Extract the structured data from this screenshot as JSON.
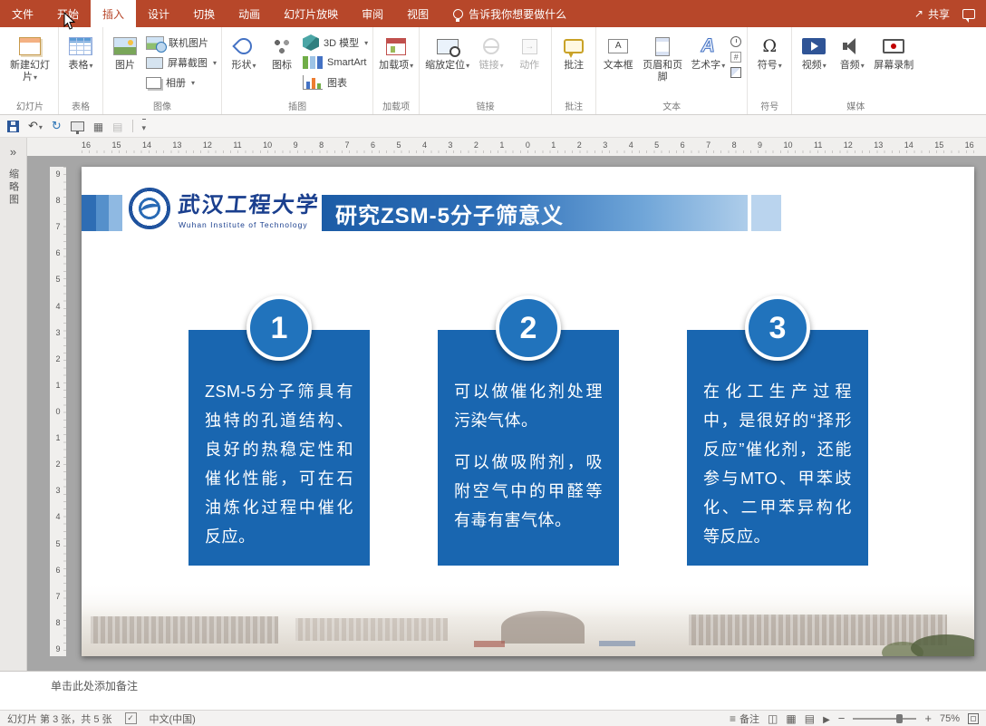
{
  "colors": {
    "ribbon_red": "#B7472A",
    "box_blue": "#1966B0",
    "title_gradient_start": "#1C5CA6",
    "title_gradient_end": "#AECDEA",
    "circle_blue": "#2173BC"
  },
  "tabs": {
    "items": [
      "文件",
      "开始",
      "插入",
      "设计",
      "切换",
      "动画",
      "幻灯片放映",
      "审阅",
      "视图"
    ],
    "active": "插入",
    "tell_me": "告诉我你想要做什么",
    "share_label": "共享"
  },
  "ribbon": {
    "slides": {
      "label": "幻灯片",
      "new_slide": "新建幻灯片"
    },
    "tables": {
      "label": "表格",
      "table": "表格"
    },
    "images": {
      "label": "图像",
      "picture": "图片",
      "online_pictures": "联机图片",
      "screenshot": "屏幕截图",
      "photo_album": "相册"
    },
    "illustrations": {
      "label": "插图",
      "shapes": "形状",
      "icons": "图标",
      "model_3d": "3D 模型",
      "smartart": "SmartArt",
      "chart": "图表"
    },
    "addins": {
      "label": "加载项",
      "addins": "加载项"
    },
    "links": {
      "label": "链接",
      "zoom": "缩放定位",
      "link": "链接",
      "action": "动作"
    },
    "comments": {
      "label": "批注",
      "comment": "批注"
    },
    "text": {
      "label": "文本",
      "text_box": "文本框",
      "header_footer": "页眉和页脚",
      "wordart": "艺术字"
    },
    "symbols": {
      "label": "符号",
      "symbol": "符号",
      "omega": "Ω"
    },
    "media": {
      "label": "媒体",
      "video": "视频",
      "audio": "音频",
      "screen_recording": "屏幕录制"
    }
  },
  "ruler": {
    "horizontal": "16 15 14 13 12 11 10 9 8 7 6 5 4 3 2 1 0 1 2 3 4 5 6 7 8 9 10 11 12 13 14 15 16",
    "vertical": "9 8 7 6 5 4 3 2 1 0 1 2 3 4 5 6 7 8 9"
  },
  "thumbnail_pane": {
    "label": "缩略图"
  },
  "slide": {
    "logo": {
      "name_zh": "武汉工程大学",
      "name_en": "Wuhan Institute of Technology"
    },
    "title": "研究ZSM-5分子筛意义",
    "items": [
      {
        "number": "1",
        "paragraphs": [
          "ZSM-5分子筛具有独特的孔道结构、良好的热稳定性和催化性能，可在石油炼化过程中催化反应。"
        ]
      },
      {
        "number": "2",
        "paragraphs": [
          "可以做催化剂处理污染气体。",
          "可以做吸附剂，吸附空气中的甲醛等有毒有害气体。"
        ]
      },
      {
        "number": "3",
        "paragraphs": [
          "在化工生产过程中，是很好的“择形反应”催化剂，还能参与MTO、甲苯歧化、二甲苯异构化等反应。"
        ]
      }
    ]
  },
  "notes": {
    "placeholder": "单击此处添加备注"
  },
  "status": {
    "slide_info": "幻灯片 第 3 张，共 5 张",
    "language": "中文(中国)",
    "notes_label": "备注",
    "zoom": "75%"
  }
}
